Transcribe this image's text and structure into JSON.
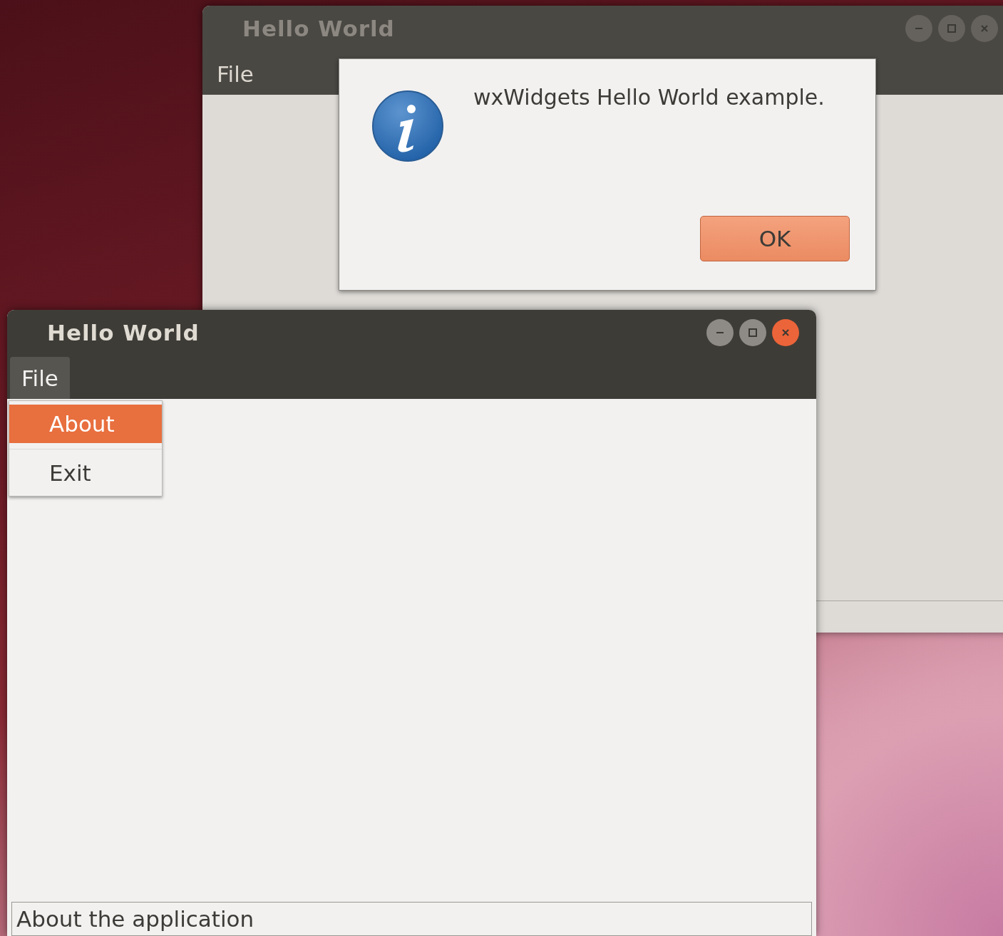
{
  "windows": [
    {
      "title": "Hello World",
      "active": false,
      "menu": [
        {
          "label": "File",
          "open": false
        }
      ]
    },
    {
      "title": "Hello World",
      "active": true,
      "menu": [
        {
          "label": "File",
          "open": true
        }
      ],
      "dropdown": [
        {
          "label": "About",
          "selected": true
        },
        {
          "label": "Exit",
          "selected": false
        }
      ],
      "status": "About the application"
    }
  ],
  "dialog": {
    "message": "wxWidgets Hello World example.",
    "buttons": [
      "OK"
    ]
  }
}
